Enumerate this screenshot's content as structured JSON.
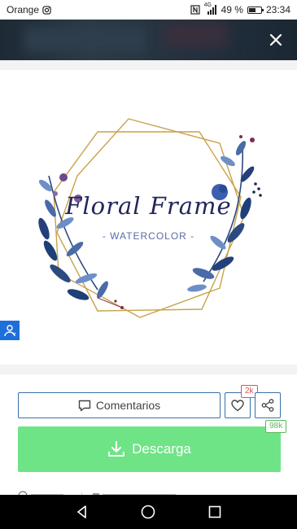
{
  "status_bar": {
    "carrier": "Orange",
    "signal": "4G",
    "battery_pct": "49 %",
    "battery_level": 0.49,
    "time": "23:34"
  },
  "header": {
    "close_icon": "close-icon"
  },
  "image": {
    "title": "Floral Frame",
    "subtitle": "- WATERCOLOR -"
  },
  "actions": {
    "comments_label": "Comentarios",
    "likes_count": "2k",
    "downloads_count": "98k",
    "download_label": "Descarga"
  },
  "colors": {
    "accent_blue": "#1e6fd9",
    "download_green": "#6ee487",
    "likes_red": "#d9534f"
  },
  "nav": {
    "back_icon": "back-icon",
    "home_icon": "home-icon",
    "recents_icon": "recents-icon"
  }
}
